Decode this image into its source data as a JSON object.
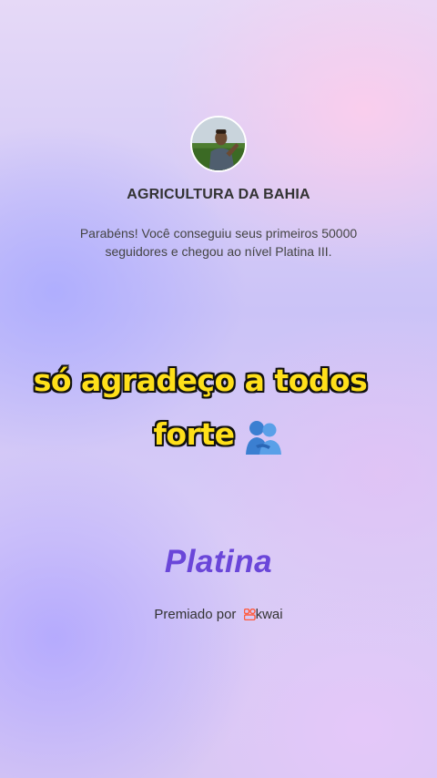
{
  "profile": {
    "name": "AGRICULTURA DA BAHIA",
    "message": "Parabéns! Você conseguiu seus primeiros 50000 seguidores e chegou ao nível Platina III."
  },
  "caption": {
    "line1": "só agradeço a todos",
    "line2": "forte",
    "emoji_icon": "people-hugging-icon"
  },
  "badge": {
    "level": "Platina"
  },
  "footer": {
    "awarded_by": "Premiado por",
    "brand": "kwai",
    "brand_icon": "kwai-logo-icon",
    "brand_color": "#ff5a3c"
  },
  "colors": {
    "caption_text": "#ffe01a",
    "level_text": "#6a46d9"
  }
}
